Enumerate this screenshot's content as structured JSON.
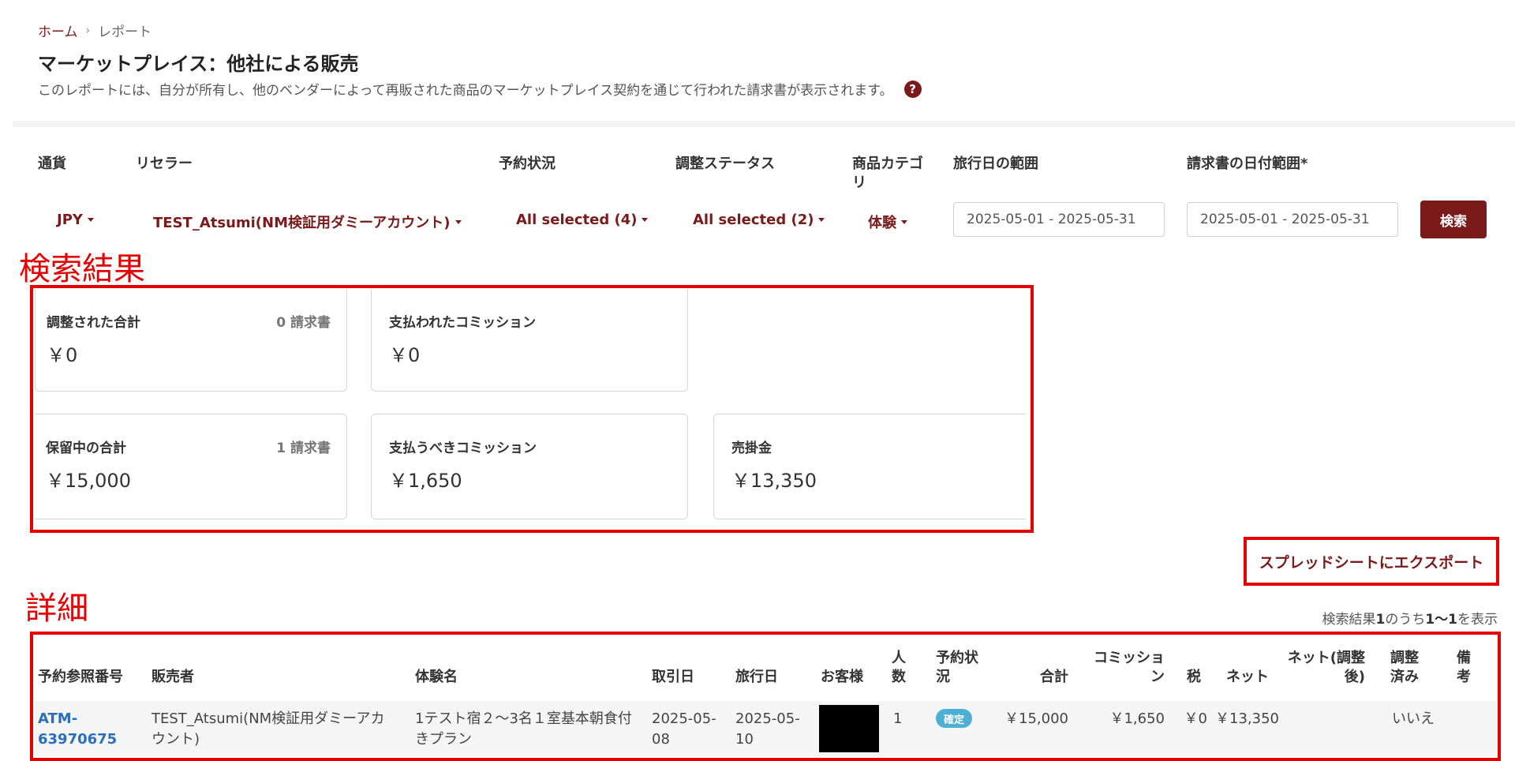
{
  "breadcrumb": {
    "home": "ホーム",
    "separator": "›",
    "current": "レポート"
  },
  "page": {
    "title": "マーケットプレイス：他社による販売",
    "description": "このレポートには、自分が所有し、他のベンダーによって再販された商品のマーケットプレイス契約を通じて行われた請求書が表示されます。",
    "help_icon": "?"
  },
  "filters": {
    "currency": {
      "label": "通貨",
      "value": "JPY"
    },
    "reseller": {
      "label": "リセラー",
      "value": "TEST_Atsumi(NM検証用ダミーアカウント)"
    },
    "booking_status": {
      "label": "予約状況",
      "value": "All selected (4)"
    },
    "adjust_status": {
      "label": "調整ステータス",
      "value": "All selected (2)"
    },
    "category": {
      "label": "商品カテゴリ",
      "value": "体験"
    },
    "travel_range": {
      "label": "旅行日の範囲",
      "value": "2025-05-01 - 2025-05-31"
    },
    "invoice_range": {
      "label": "請求書の日付範囲*",
      "value": "2025-05-01 - 2025-05-31"
    },
    "search_label": "検索"
  },
  "annotations": {
    "results": "検索結果",
    "details": "詳細"
  },
  "summary": {
    "adjusted_total": {
      "title": "調整された合計",
      "count": "0 請求書",
      "value": "￥0"
    },
    "commission_paid": {
      "title": "支払われたコミッション",
      "value": "￥0"
    },
    "held_total": {
      "title": "保留中の合計",
      "count": "1 請求書",
      "value": "￥15,000"
    },
    "commission_due": {
      "title": "支払うべきコミッション",
      "value": "￥1,650"
    },
    "receivable": {
      "title": "売掛金",
      "value": "￥13,350"
    }
  },
  "export_label": "スプレッドシートにエクスポート",
  "results_count": {
    "prefix": "検索結果",
    "total": "1",
    "mid": "のうち",
    "range": "1〜1",
    "suffix": "を表示"
  },
  "table": {
    "headers": {
      "ref": "予約参照番号",
      "seller": "販売者",
      "product": "体験名",
      "trade_date": "取引日",
      "travel_date": "旅行日",
      "customer": "お客様",
      "pax": "人数",
      "status": "予約状況",
      "total": "合計",
      "commission": "コミッション",
      "tax": "税",
      "net": "ネット",
      "net_adjusted": "ネット(調整後)",
      "adjusted": "調整済み",
      "notes": "備考"
    },
    "rows": [
      {
        "ref": "ATM-63970675",
        "seller": "TEST_Atsumi(NM検証用ダミーアカウント)",
        "product": "1テスト宿２〜3名１室基本朝食付きプラン",
        "trade_date": "2025-05-08",
        "travel_date": "2025-05-10",
        "pax": "1",
        "status": "確定",
        "total": "￥15,000",
        "commission": "￥1,650",
        "tax": "￥0",
        "net": "￥13,350",
        "net_adjusted": "",
        "adjusted": "いいえ",
        "notes": ""
      }
    ]
  },
  "colors": {
    "brand": "#7a1a1a",
    "annotation_red": "#e60000",
    "link": "#2a6fb8",
    "badge": "#4dafd6"
  }
}
